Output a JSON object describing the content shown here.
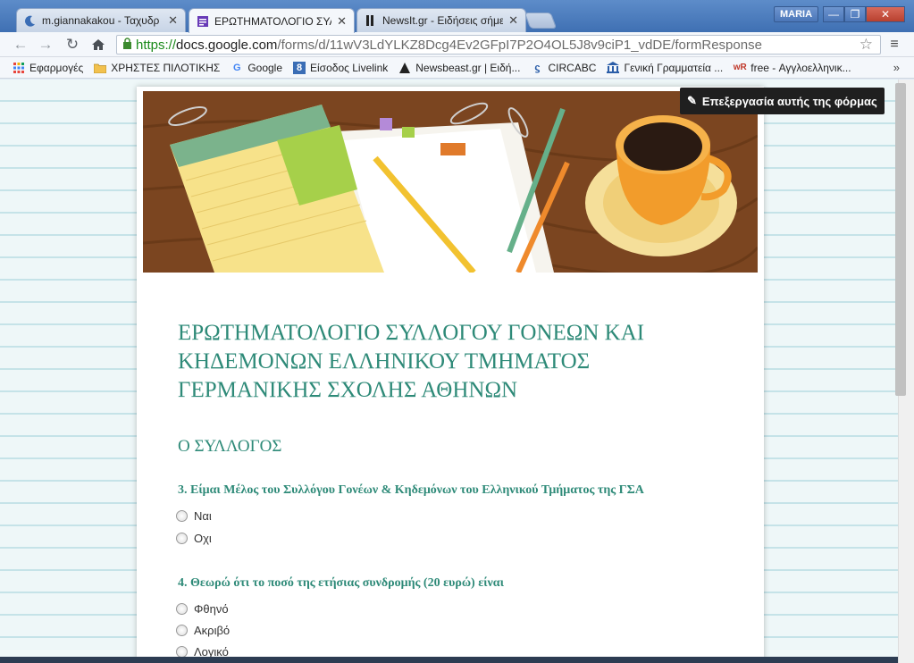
{
  "browser": {
    "tabs": [
      {
        "title": "m.giannakakou - Ταχυδρ",
        "icon": "moon-icon",
        "active": false
      },
      {
        "title": "ΕΡΩΤΗΜΑΤΟΛΟΓΙΟ ΣΥΛ",
        "icon": "forms-icon",
        "active": true
      },
      {
        "title": "NewsIt.gr - Ειδήσεις σήμε",
        "icon": "newsit-icon",
        "active": false
      }
    ],
    "user": "MARIA",
    "url": {
      "scheme": "https://",
      "host": "docs.google.com",
      "path": "/forms/d/11wV3LdYLKZ8Dcg4Ev2GFpI7P2O4OL5J8v9ciP1_vdDE/formResponse"
    },
    "bookmarks": [
      {
        "label": "Εφαρμογές",
        "icon": "apps-grid-icon"
      },
      {
        "label": "ΧΡΗΣΤΕΣ ΠΙΛΟΤΙΚΗΣ",
        "icon": "folder-icon"
      },
      {
        "label": "Google",
        "icon": "google-icon"
      },
      {
        "label": "Είσοδος Livelink",
        "icon": "livelink-icon"
      },
      {
        "label": "Newsbeast.gr | Ειδή...",
        "icon": "newsbeast-icon"
      },
      {
        "label": "CIRCABC",
        "icon": "circabc-icon"
      },
      {
        "label": "Γενική Γραμματεία ...",
        "icon": "building-icon"
      },
      {
        "label": "free - Αγγλοελληνικ...",
        "icon": "wordreference-icon"
      }
    ],
    "bookmarks_more": "»"
  },
  "form": {
    "edit_button": "Επεξεργασία αυτής της φόρμας",
    "title": "ΕΡΩΤΗΜΑΤΟΛΟΓΙΟ ΣΥΛΛΟΓΟΥ ΓΟΝΕΩΝ ΚΑΙ ΚΗΔΕΜΟΝΩΝ ΕΛΛΗΝΙΚΟΥ ΤΜΗΜΑΤΟΣ ΓΕΡΜΑΝΙΚΗΣ ΣΧΟΛΗΣ ΑΘΗΝΩΝ",
    "section": "Ο ΣΥΛΛΟΓΟΣ",
    "questions": [
      {
        "text": "3. Είμαι Μέλος του Συλλόγου Γονέων & Κηδεμόνων του Ελληνικού Τμήματος της ΓΣΑ",
        "options": [
          "Ναι",
          "Οχι"
        ]
      },
      {
        "text": "4. Θεωρώ ότι το ποσό της ετήσιας συνδρομής (20 ευρώ) είναι",
        "options": [
          "Φθηνό",
          "Ακριβό",
          "Λογικό"
        ]
      }
    ]
  },
  "colors": {
    "accent": "#2e8a78",
    "page_background": "#eef7f8",
    "ruled_line": "#c5e3e8"
  }
}
